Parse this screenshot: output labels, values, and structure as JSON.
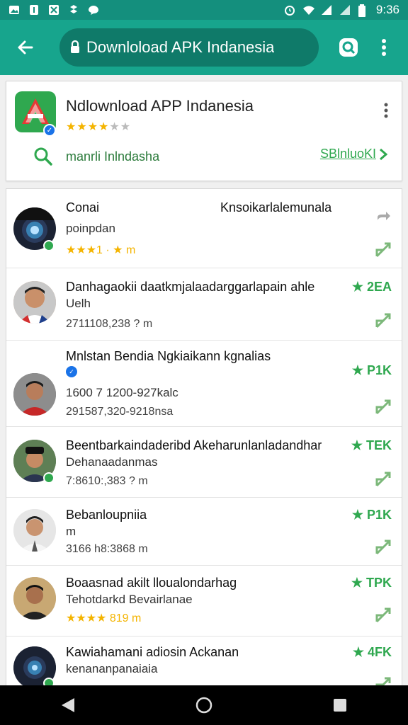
{
  "status_bar": {
    "time": "9:36",
    "left_icons": [
      "image-icon",
      "notification-icon",
      "gallery-icon",
      "dropbox-icon",
      "chat-icon"
    ],
    "right_icons": [
      "alarm-icon",
      "wifi-icon",
      "signal-icon",
      "signal-icon",
      "battery-icon"
    ]
  },
  "app_bar": {
    "url_text": "Downloload APK Indanesia"
  },
  "header": {
    "title": "Ndlownload APP Indanesia",
    "rating_stars": "★★★★★",
    "search_label": "manrli Inlndasha",
    "link_label": "SBlnluoKI"
  },
  "rows": [
    {
      "title": "Conai",
      "title_right": "Knsoikarlalemunala",
      "sub": "poinpdan",
      "meta": "★★★1 · ★ m",
      "stat": ""
    },
    {
      "title": "Danhagaokii daatkmjalaadarggarlapain ahle",
      "sub": "Uelh",
      "meta": "2711108,238 ? m",
      "stat": "★ 2EA"
    },
    {
      "title": "Mnlstan Bendia Ngkiaikann kgnalias",
      "sub": "1600 7 1200-927kalc",
      "meta": "291587,320-9218nsa",
      "stat": "★ P1K"
    },
    {
      "title": "Beentbarkaindaderibd Akeharunlanladandhar",
      "sub": "Dehanaadanmas",
      "meta": "7:8610:,383 ? m",
      "stat": "★ TEK"
    },
    {
      "title": "Bebanloupniia",
      "sub": "m",
      "meta": "3166 h8:3868 m",
      "stat": "★ P1K"
    },
    {
      "title": "Boaasnad akilt lloualondarhag",
      "sub": "Tehotdarkd Bevairlanae",
      "meta": "★★★★ 819 m",
      "stat": "★ TPK"
    },
    {
      "title": "Kawiahamani adiosin Ackanan",
      "sub": "kenananpanaiaia",
      "meta": "",
      "stat": "★ 4FK"
    }
  ],
  "colors": {
    "status_bar": "#148f7d",
    "app_bar": "#17a58d",
    "url_pill": "#0f7a69",
    "accent_green": "#2fa84f",
    "star": "#f4b400"
  }
}
